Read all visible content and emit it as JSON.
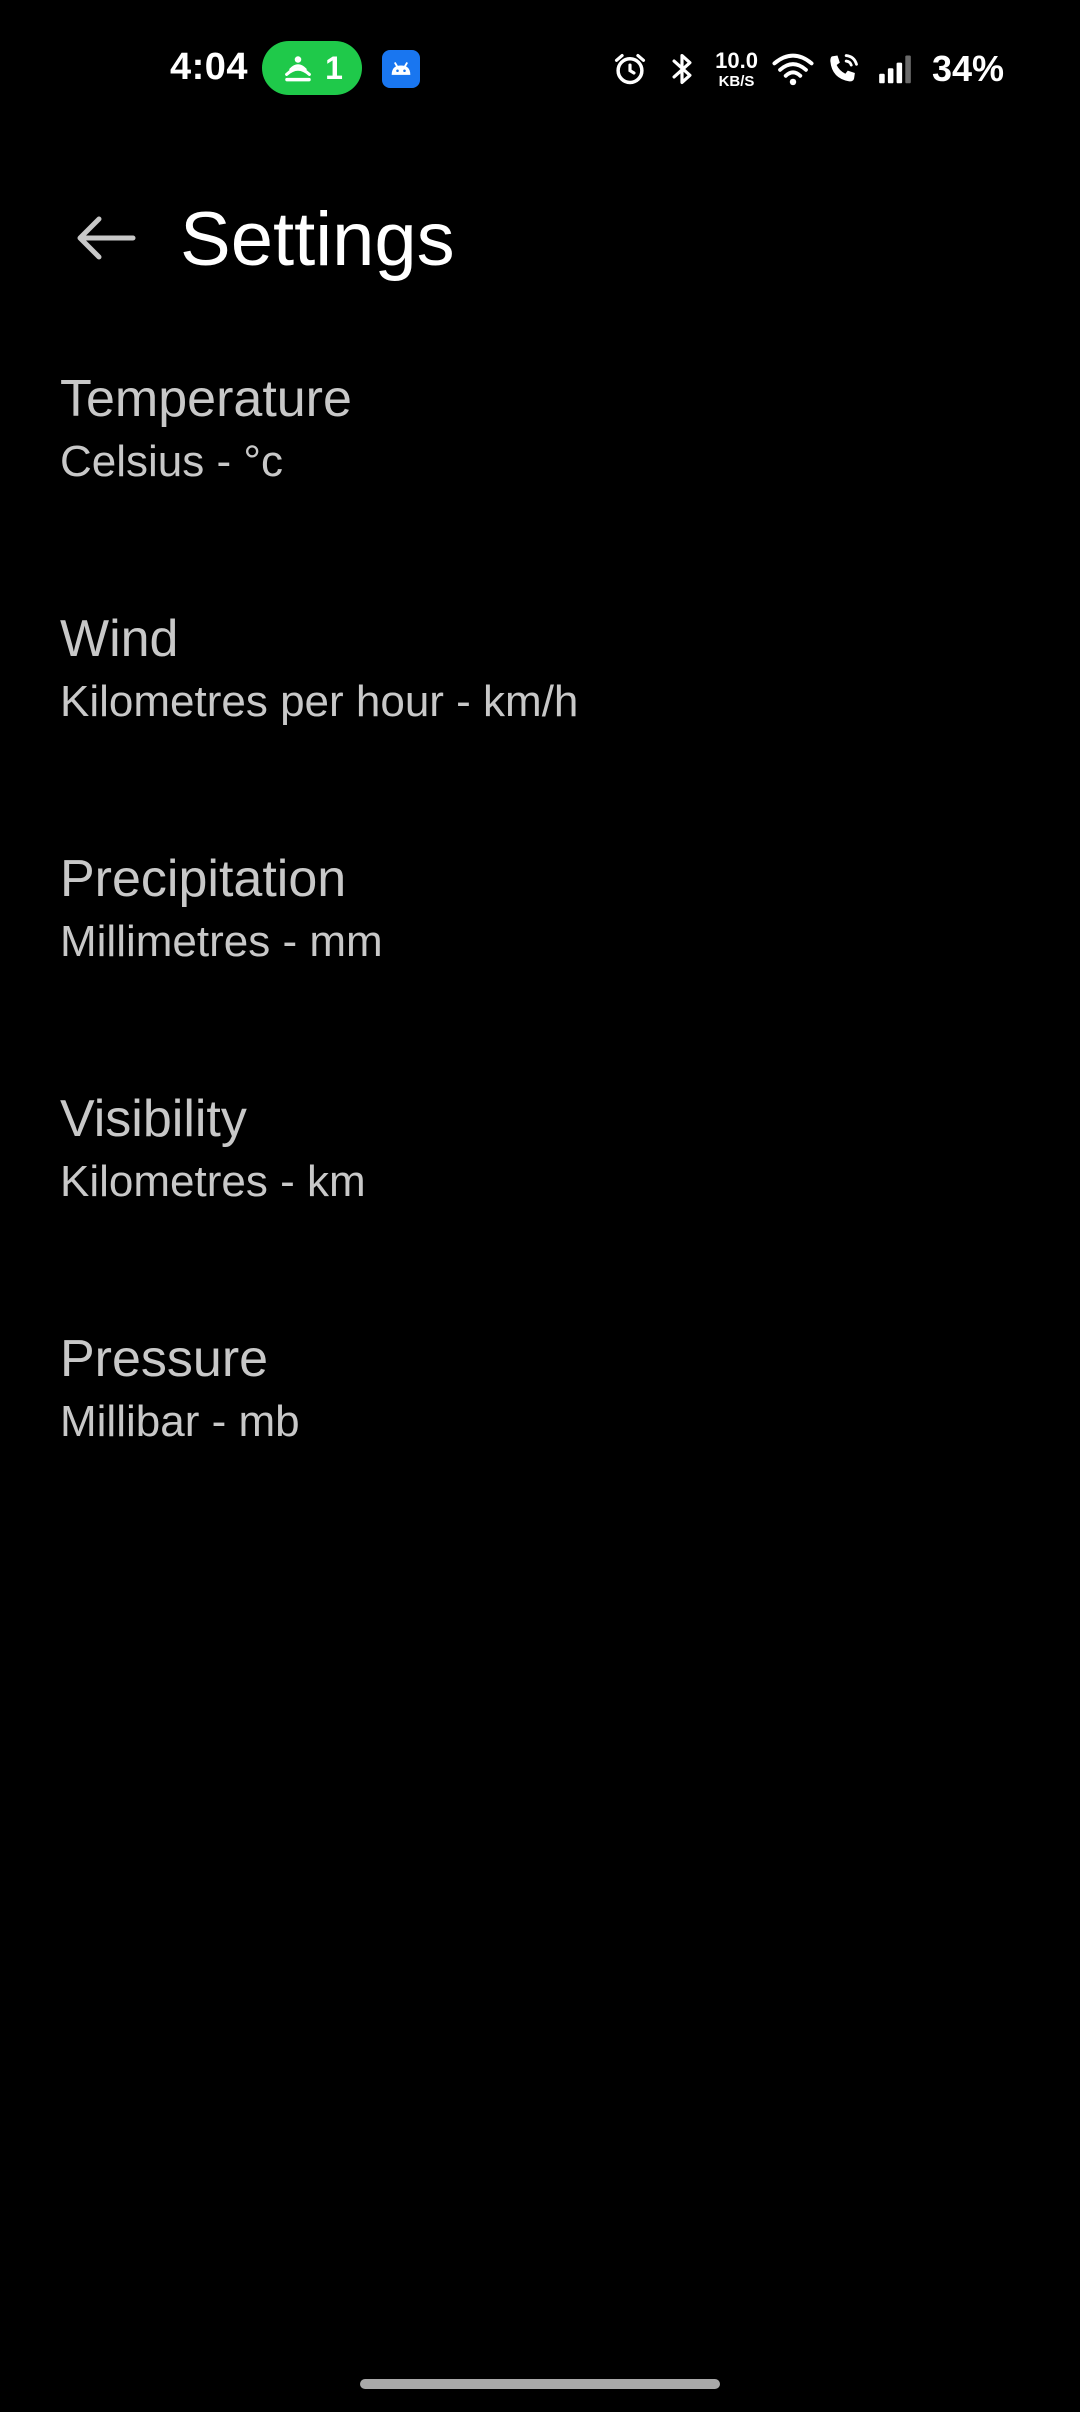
{
  "status_bar": {
    "time": "4:04",
    "hotspot_count": "1",
    "net_speed_value": "10.0",
    "net_speed_unit": "KB/S",
    "battery": "34%",
    "icons": [
      "hotspot-icon",
      "android-icon",
      "alarm-icon",
      "bluetooth-icon",
      "wifi-icon",
      "wifi-calling-icon",
      "signal-icon"
    ]
  },
  "app_bar": {
    "title": "Settings",
    "back_icon": "arrow-left-icon"
  },
  "settings": [
    {
      "title": "Temperature",
      "value": "Celsius - °c"
    },
    {
      "title": "Wind",
      "value": "Kilometres per hour - km/h"
    },
    {
      "title": "Precipitation",
      "value": "Millimetres - mm"
    },
    {
      "title": "Visibility",
      "value": "Kilometres - km"
    },
    {
      "title": "Pressure",
      "value": "Millibar - mb"
    }
  ],
  "colors": {
    "background": "#000000",
    "text_primary": "#ffffff",
    "text_secondary": "#c8c8c8",
    "hotspot_pill": "#1fc94a",
    "app_notif": "#1976f0"
  }
}
